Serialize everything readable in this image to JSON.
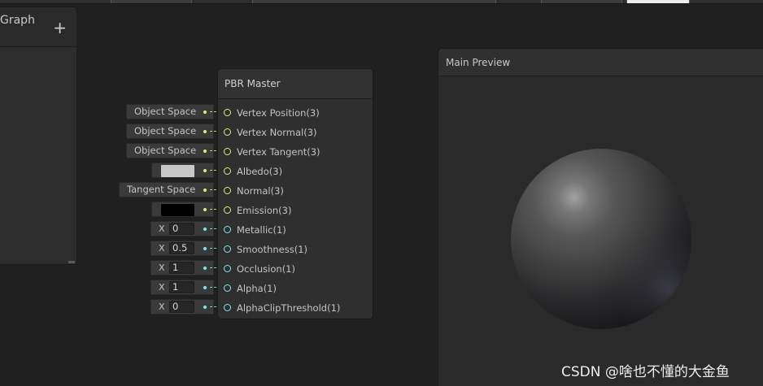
{
  "blackboard": {
    "title": "Graph",
    "add_icon": "+"
  },
  "node": {
    "title": "PBR Master",
    "slots": [
      {
        "label": "Vertex Position(3)",
        "type": "vector"
      },
      {
        "label": "Vertex Normal(3)",
        "type": "vector"
      },
      {
        "label": "Vertex Tangent(3)",
        "type": "vector"
      },
      {
        "label": "Albedo(3)",
        "type": "vector"
      },
      {
        "label": "Normal(3)",
        "type": "vector"
      },
      {
        "label": "Emission(3)",
        "type": "vector"
      },
      {
        "label": "Metallic(1)",
        "type": "float"
      },
      {
        "label": "Smoothness(1)",
        "type": "float"
      },
      {
        "label": "Occlusion(1)",
        "type": "float"
      },
      {
        "label": "Alpha(1)",
        "type": "float"
      },
      {
        "label": "AlphaClipThreshold(1)",
        "type": "float"
      }
    ]
  },
  "inputs": {
    "vertex_position": "Object Space",
    "vertex_normal": "Object Space",
    "vertex_tangent": "Object Space",
    "albedo_color": "#c8c8c8",
    "normal": "Tangent Space",
    "emission_color": "#000000",
    "float_axis_label": "X",
    "metallic": "0",
    "smoothness": "0.5",
    "occlusion": "1",
    "alpha": "1",
    "alpha_clip_threshold": "0"
  },
  "colors": {
    "vector_port": "#e6e680",
    "float_port": "#84e4f0",
    "background": "#202020"
  },
  "preview": {
    "title": "Main Preview"
  },
  "watermark": "CSDN @啥也不懂的大金鱼"
}
